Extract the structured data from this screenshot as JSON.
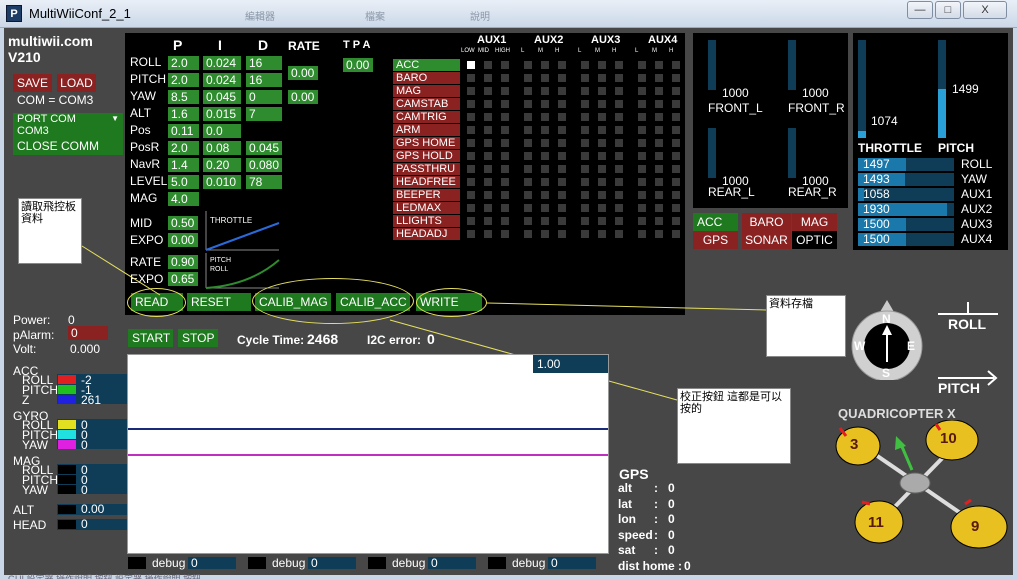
{
  "window": {
    "title": "MultiWiiConf_2_1",
    "icon_letter": "P",
    "minimize": "—",
    "maximize": "□",
    "close": "X",
    "bg_tab1": "編輯器",
    "bg_tab2": "檔案",
    "bg_tab3": "說明"
  },
  "brand": {
    "name": "multiwii.com",
    "version": "V210"
  },
  "buttons": {
    "save": "SAVE",
    "load": "LOAD",
    "com": "COM = COM3",
    "port": "PORT COM",
    "port_value": "COM3",
    "close": "CLOSE COMM",
    "read": "READ",
    "reset": "RESET",
    "calib_mag": "CALIB_MAG",
    "calib_acc": "CALIB_ACC",
    "write": "WRITE",
    "start": "START",
    "stop": "STOP"
  },
  "pid_headers": {
    "p": "P",
    "i": "I",
    "d": "D",
    "rate": "RATE",
    "tpa": "T P A"
  },
  "pid": [
    {
      "name": "ROLL",
      "p": "2.0",
      "i": "0.024",
      "d": "16"
    },
    {
      "name": "PITCH",
      "p": "2.0",
      "i": "0.024",
      "d": "16"
    },
    {
      "name": "YAW",
      "p": "8.5",
      "i": "0.045",
      "d": "0"
    },
    {
      "name": "ALT",
      "p": "1.6",
      "i": "0.015",
      "d": "7"
    },
    {
      "name": "Pos",
      "p": "0.11",
      "i": "0.0",
      "d": ""
    },
    {
      "name": "PosR",
      "p": "2.0",
      "i": "0.08",
      "d": "0.045"
    },
    {
      "name": "NavR",
      "p": "1.4",
      "i": "0.20",
      "d": "0.080"
    },
    {
      "name": "LEVEL",
      "p": "5.0",
      "i": "0.010",
      "d": "78"
    },
    {
      "name": "MAG",
      "p": "4.0",
      "i": "",
      "d": ""
    }
  ],
  "rates": {
    "rollpitch": "0.00",
    "yaw": "0.00",
    "tpa": "0.00"
  },
  "throttle": {
    "mid_label": "MID",
    "mid": "0.50",
    "expo_label": "EXPO",
    "expo": "0.00",
    "graph": "THROTTLE"
  },
  "rate": {
    "rate_label": "RATE",
    "rate": "0.90",
    "expo_label": "EXPO",
    "expo": "0.65",
    "graph1": "PITCH",
    "graph2": "ROLL"
  },
  "boxes": [
    "ACC",
    "BARO",
    "MAG",
    "CAMSTAB",
    "CAMTRIG",
    "ARM",
    "GPS HOME",
    "GPS HOLD",
    "PASSTHRU",
    "HEADFREE",
    "BEEPER",
    "LEDMAX",
    "LLIGHTS",
    "HEADADJ"
  ],
  "aux": {
    "headers": [
      "AUX1",
      "AUX2",
      "AUX3",
      "AUX4"
    ],
    "sub1": [
      "LOW",
      "MID",
      "HIGH"
    ],
    "sub": [
      "L",
      "M",
      "H"
    ]
  },
  "motors": [
    {
      "label": "FRONT_L",
      "value": "1000",
      "level": 0.0
    },
    {
      "label": "FRONT_R",
      "value": "1000",
      "level": 0.0
    },
    {
      "label": "REAR_L",
      "value": "1000",
      "level": 0.0
    },
    {
      "label": "REAR_R",
      "value": "1000",
      "level": 0.0
    }
  ],
  "sensors": {
    "acc": "ACC",
    "baro": "BARO",
    "mag": "MAG",
    "gps": "GPS",
    "sonar": "SONAR",
    "optic": "OPTIC"
  },
  "rc": {
    "throttle": {
      "label": "THROTTLE",
      "value": "1074",
      "level": 0.07
    },
    "pitch": {
      "label": "PITCH",
      "value": "1499",
      "level": 0.5
    },
    "channels": [
      {
        "label": "ROLL",
        "value": "1497",
        "level": 0.5
      },
      {
        "label": "YAW",
        "value": "1493",
        "level": 0.49
      },
      {
        "label": "AUX1",
        "value": "1058",
        "level": 0.06
      },
      {
        "label": "AUX2",
        "value": "1930",
        "level": 0.93
      },
      {
        "label": "AUX3",
        "value": "1500",
        "level": 0.5
      },
      {
        "label": "AUX4",
        "value": "1500",
        "level": 0.5
      }
    ]
  },
  "power": {
    "power_label": "Power:",
    "power": "0",
    "alarm_label": "pAlarm:",
    "alarm": "0",
    "volt_label": "Volt:",
    "volt": "0.000"
  },
  "status": {
    "cycle_label": "Cycle Time:",
    "cycle": "2468",
    "i2c_label": "I2C error:",
    "i2c": "0"
  },
  "graph": {
    "scale": "1.00"
  },
  "sens_acc": {
    "title": "ACC",
    "roll": "ROLL",
    "pitch": "PITCH",
    "z": "Z",
    "v_roll": "-2",
    "v_pitch": "-1",
    "v_z": "261"
  },
  "sens_gyro": {
    "title": "GYRO",
    "roll": "ROLL",
    "pitch": "PITCH",
    "yaw": "YAW",
    "v_roll": "0",
    "v_pitch": "0",
    "v_yaw": "0"
  },
  "sens_mag": {
    "title": "MAG",
    "roll": "ROLL",
    "pitch": "PITCH",
    "yaw": "YAW",
    "v_roll": "0",
    "v_pitch": "0",
    "v_yaw": "0"
  },
  "alt": {
    "label": "ALT",
    "value": "0.00"
  },
  "head": {
    "label": "HEAD",
    "value": "0"
  },
  "debug": [
    {
      "label": "debug",
      "value": "0"
    },
    {
      "label": "debug",
      "value": "0"
    },
    {
      "label": "debug",
      "value": "0"
    },
    {
      "label": "debug",
      "value": "0"
    }
  ],
  "gps": {
    "title": "GPS",
    "alt_l": "alt",
    "alt": "0",
    "lat_l": "lat",
    "lat": "0",
    "lon_l": "lon",
    "lon": "0",
    "speed_l": "speed",
    "speed": "0",
    "sat_l": "sat",
    "sat": "0",
    "dist_l": "dist home",
    "dist": "0",
    "colon": ":"
  },
  "compass": {
    "n": "N",
    "s": "S",
    "e": "E",
    "w": "W"
  },
  "attitude": {
    "roll": "ROLL",
    "pitch": "PITCH"
  },
  "quad": {
    "title": "QUADRICOPTER X",
    "m1": "3",
    "m2": "10",
    "m3": "11",
    "m4": "9"
  },
  "notes": {
    "read_note": "讀取飛控板資料",
    "write_note": "資料存檔",
    "calib_note": "校正按鈕 這都是可以按的"
  },
  "bottom_ghost": "GUI 設定器 操作說明 按鈕 設定器 操作說明 按鈕"
}
